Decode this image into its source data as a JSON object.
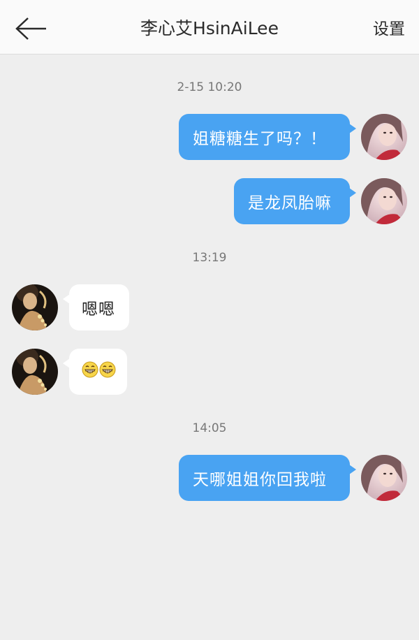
{
  "header": {
    "title": "李心艾HsinAiLee",
    "settings_label": "设置"
  },
  "messages": {
    "ts1": "2-15 10:20",
    "m1": "姐糖糖生了吗？！",
    "m2": "是龙凤胎嘛",
    "ts2": "13:19",
    "m3": "嗯嗯",
    "m4_emoji": "grinning-faces-emoji",
    "ts3": "14:05",
    "m5": "天哪姐姐你回我啦"
  },
  "colors": {
    "outgoing_bubble": "#49a3f2",
    "incoming_bubble": "#ffffff",
    "background": "#eeeeee"
  }
}
